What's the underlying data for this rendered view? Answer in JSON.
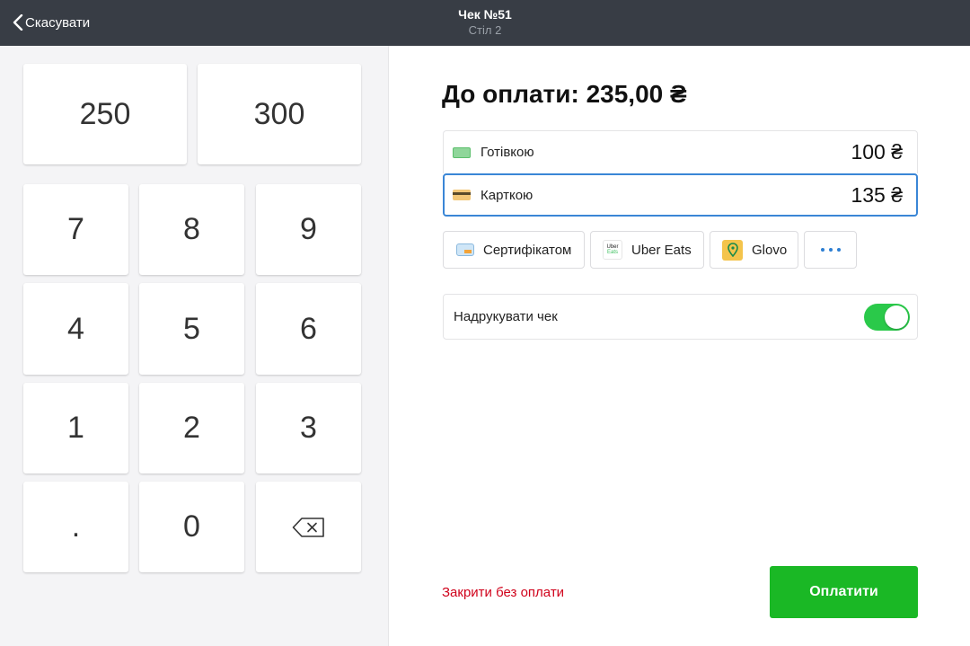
{
  "header": {
    "back_label": "Скасувати",
    "title": "Чек №51",
    "subtitle": "Стіл 2"
  },
  "keypad": {
    "quick": [
      "250",
      "300"
    ],
    "keys": [
      "7",
      "8",
      "9",
      "4",
      "5",
      "6",
      "1",
      "2",
      "3",
      ".",
      "0"
    ],
    "backspace_icon": "backspace-icon"
  },
  "payment": {
    "due_label": "До оплати: 235,00 ₴",
    "cash": {
      "label": "Готівкою",
      "amount": "100 ₴",
      "icon": "cash-icon"
    },
    "card": {
      "label": "Карткою",
      "amount": "135 ₴",
      "icon": "card-icon"
    },
    "methods": [
      {
        "label": "Сертифікатом",
        "icon": "certificate-icon"
      },
      {
        "label": "Uber Eats",
        "icon": "uber-eats-icon",
        "icon_text": [
          "Uber",
          "Eats"
        ]
      },
      {
        "label": "Glovo",
        "icon": "glovo-icon"
      }
    ],
    "more_icon": "more-dots-icon",
    "print_label": "Надрукувати чек",
    "print_enabled": true,
    "close_label": "Закрити без оплати",
    "pay_label": "Оплатити"
  },
  "colors": {
    "header_bg": "#383d45",
    "accent_blue": "#3a86d6",
    "pay_green": "#1ab825",
    "toggle_green": "#2ac94a",
    "danger_red": "#d0021b"
  }
}
